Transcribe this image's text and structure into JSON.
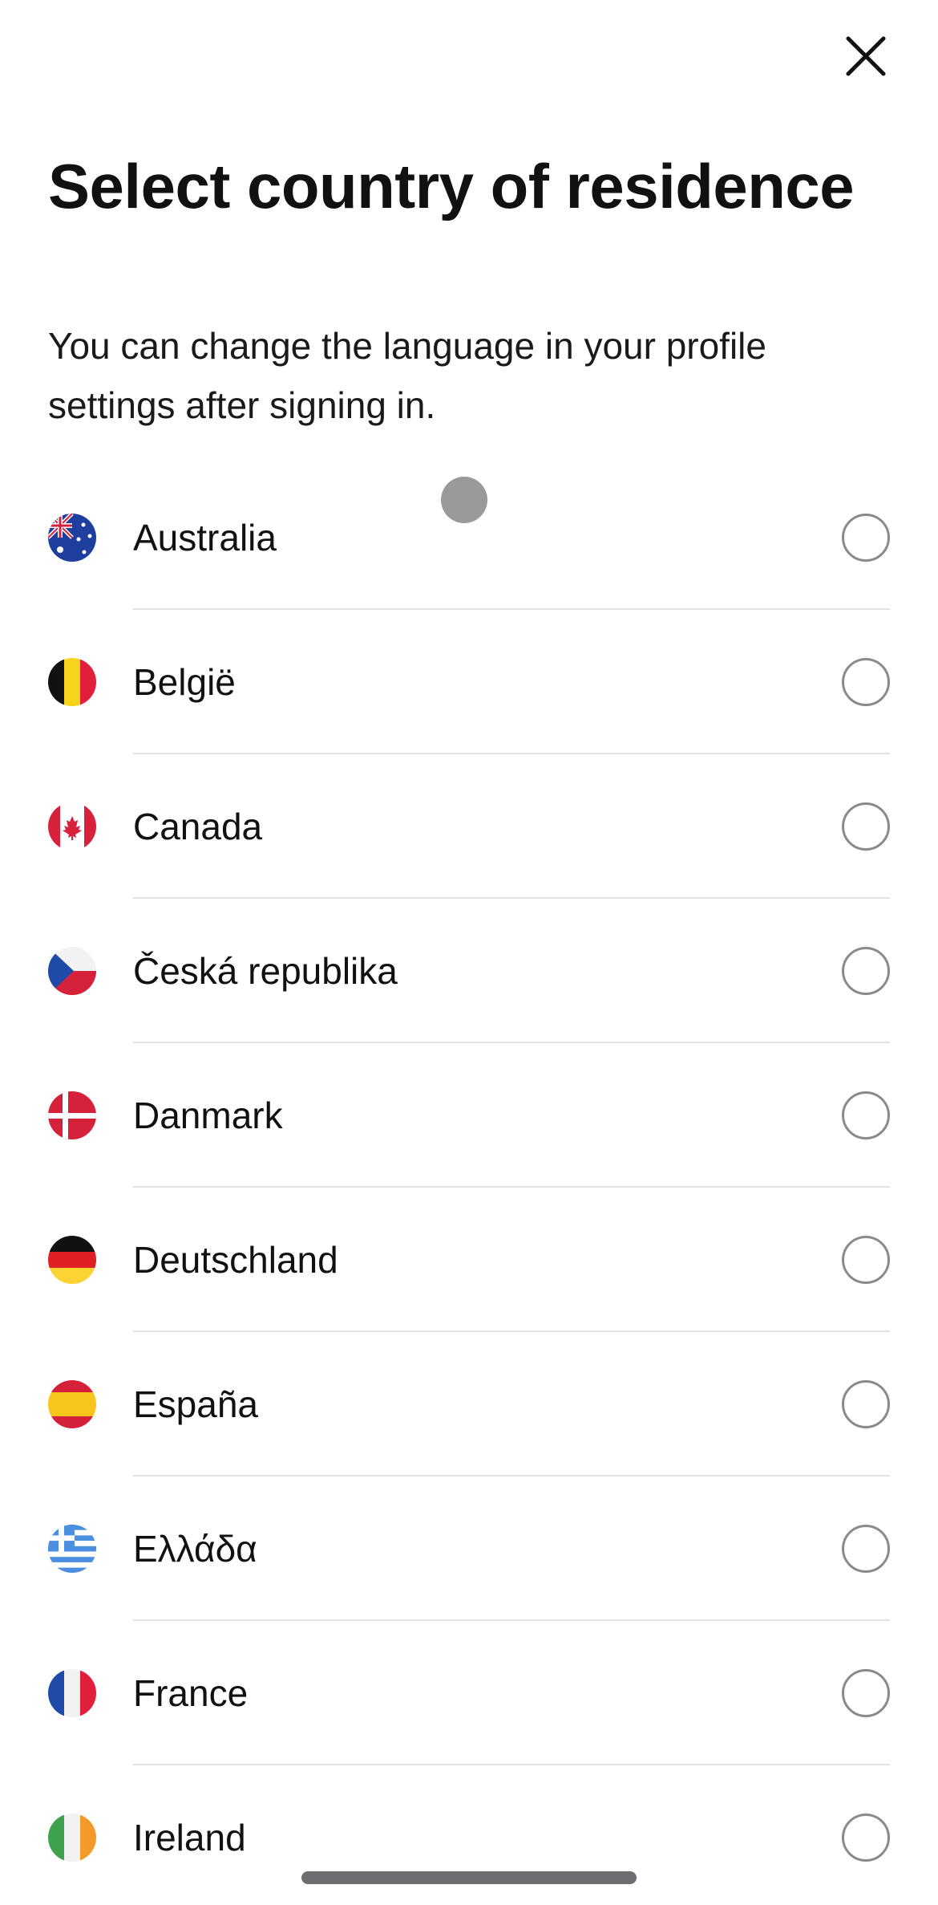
{
  "header": {
    "close_icon": "close-icon"
  },
  "title": "Select country of residence",
  "subtitle": "You can change the language in your profile settings after signing in.",
  "countries": [
    {
      "name": "Australia",
      "flag": "australia-flag-icon",
      "selected": false
    },
    {
      "name": "België",
      "flag": "belgium-flag-icon",
      "selected": false
    },
    {
      "name": "Canada",
      "flag": "canada-flag-icon",
      "selected": false
    },
    {
      "name": "Česká republika",
      "flag": "czech-flag-icon",
      "selected": false
    },
    {
      "name": "Danmark",
      "flag": "denmark-flag-icon",
      "selected": false
    },
    {
      "name": "Deutschland",
      "flag": "germany-flag-icon",
      "selected": false
    },
    {
      "name": "España",
      "flag": "spain-flag-icon",
      "selected": false
    },
    {
      "name": "Ελλάδα",
      "flag": "greece-flag-icon",
      "selected": false
    },
    {
      "name": "France",
      "flag": "france-flag-icon",
      "selected": false
    },
    {
      "name": "Ireland",
      "flag": "ireland-flag-icon",
      "selected": false
    }
  ],
  "colors": {
    "text": "#111111",
    "radio_border": "#8a8a8a",
    "divider": "#e3e3e3"
  }
}
